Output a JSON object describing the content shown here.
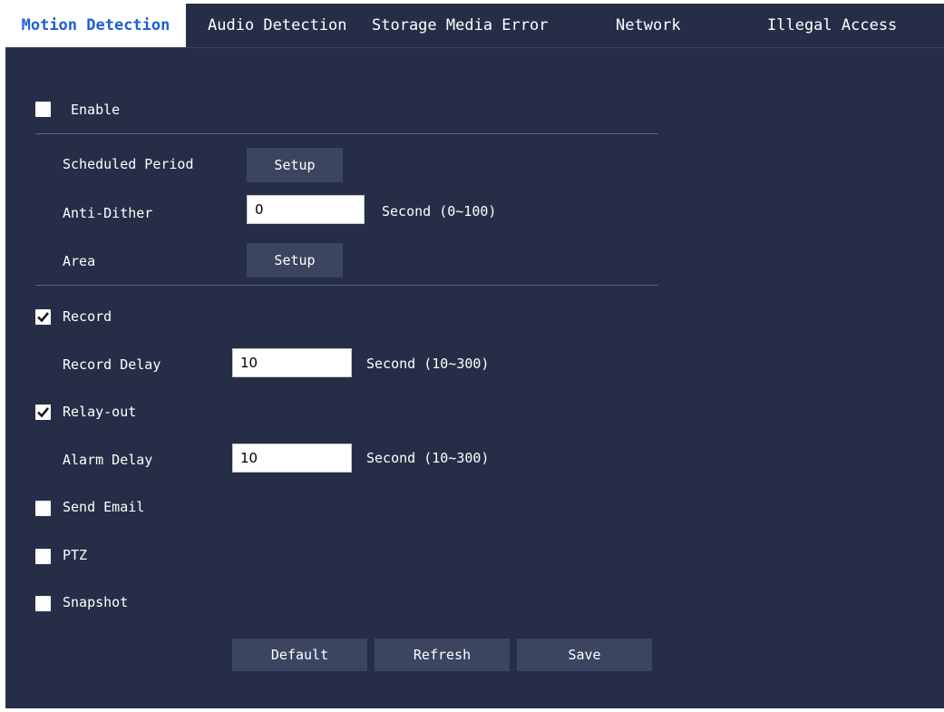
{
  "tabs": [
    {
      "label": "Motion Detection",
      "active": true
    },
    {
      "label": "Audio Detection",
      "active": false
    },
    {
      "label": "Storage Media Error",
      "active": false
    },
    {
      "label": "Network",
      "active": false
    },
    {
      "label": "Illegal Access",
      "active": false
    }
  ],
  "enable": {
    "label": "Enable",
    "checked": false
  },
  "scheduled_period": {
    "label": "Scheduled Period",
    "button": "Setup"
  },
  "anti_dither": {
    "label": "Anti-Dither",
    "value": "0",
    "unit": "Second (0~100)"
  },
  "area": {
    "label": "Area",
    "button": "Setup"
  },
  "record": {
    "label": "Record",
    "checked": true
  },
  "record_delay": {
    "label": "Record Delay",
    "value": "10",
    "unit": "Second (10~300)"
  },
  "relay_out": {
    "label": "Relay-out",
    "checked": true
  },
  "alarm_delay": {
    "label": "Alarm Delay",
    "value": "10",
    "unit": "Second (10~300)"
  },
  "send_email": {
    "label": "Send Email",
    "checked": false
  },
  "ptz": {
    "label": "PTZ",
    "checked": false
  },
  "snapshot": {
    "label": "Snapshot",
    "checked": false
  },
  "footer": {
    "default": "Default",
    "refresh": "Refresh",
    "save": "Save"
  },
  "colors": {
    "background": "#262e47",
    "active_tab_text": "#1d5fd8",
    "button": "#3c4560",
    "divider": "#5c6582"
  },
  "icons": {
    "checkmark": "check-icon"
  }
}
